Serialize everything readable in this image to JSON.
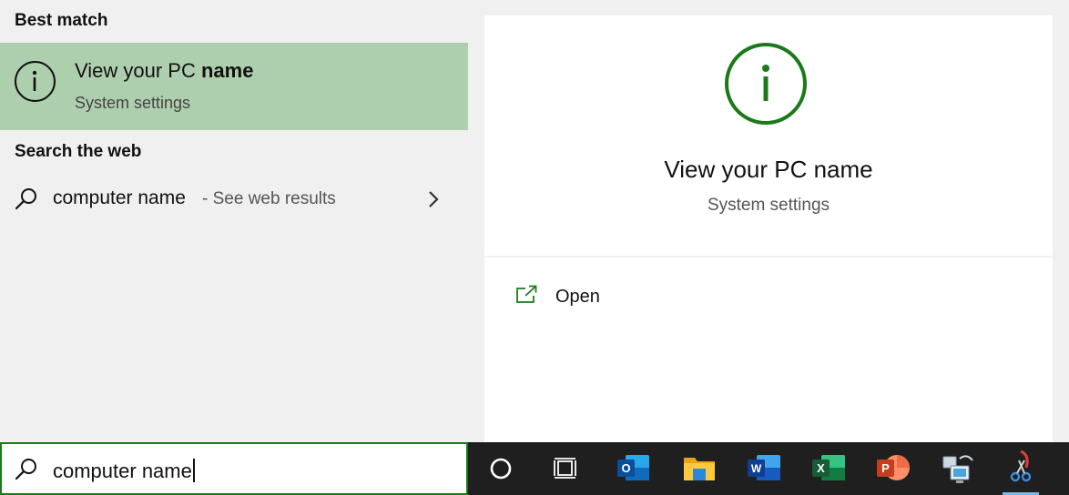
{
  "best_match": {
    "section_title": "Best match",
    "title_prefix": "View your PC ",
    "title_bold": "name",
    "subtitle": "System settings"
  },
  "search_web": {
    "section_title": "Search the web",
    "query": "computer name",
    "suffix": "- See web results"
  },
  "preview": {
    "title": "View your PC name",
    "subtitle": "System settings",
    "actions": [
      {
        "label": "Open",
        "icon": "open-icon"
      }
    ]
  },
  "search": {
    "value": "computer name"
  },
  "taskbar": {
    "apps": [
      {
        "name": "cortana",
        "icon": "cortana-icon"
      },
      {
        "name": "task-view",
        "icon": "task-view-icon"
      },
      {
        "name": "outlook",
        "icon": "outlook-icon"
      },
      {
        "name": "file-explorer",
        "icon": "file-explorer-icon"
      },
      {
        "name": "word",
        "icon": "word-icon"
      },
      {
        "name": "excel",
        "icon": "excel-icon"
      },
      {
        "name": "powerpoint",
        "icon": "powerpoint-icon"
      },
      {
        "name": "network",
        "icon": "network-computer-icon"
      },
      {
        "name": "snipping-tool",
        "icon": "snipping-tool-icon"
      }
    ]
  },
  "colors": {
    "accent_green": "#1a7a1a",
    "selected_bg": "#aecfae",
    "panel_bg": "#f0f0f0",
    "taskbar_bg": "#1f1f1f"
  }
}
